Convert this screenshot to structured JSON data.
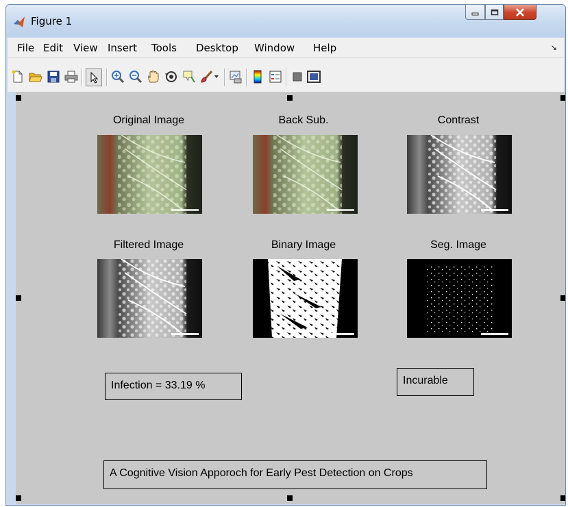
{
  "window": {
    "title": "Figure 1"
  },
  "menu": {
    "items": [
      "File",
      "Edit",
      "View",
      "Insert",
      "Tools",
      "Desktop",
      "Window",
      "Help"
    ]
  },
  "toolbar": {
    "buttons": [
      "new-figure",
      "open-file",
      "save",
      "print",
      "edit-plot",
      "zoom-in",
      "zoom-out",
      "pan",
      "rotate-3d",
      "data-cursor",
      "brush",
      "link-plot",
      "insert-colorbar",
      "insert-legend",
      "hide-plot-tools",
      "show-plot-tools"
    ]
  },
  "figure": {
    "images": [
      {
        "title": "Original Image"
      },
      {
        "title": "Back Sub."
      },
      {
        "title": "Contrast"
      },
      {
        "title": "Filtered Image"
      },
      {
        "title": "Binary Image"
      },
      {
        "title": "Seg. Image"
      }
    ],
    "infection_text": "Infection = 33.19 %",
    "status_text": "Incurable",
    "caption": "A Cognitive Vision Apporoch for Early Pest Detection on Crops"
  },
  "colors": {
    "figure_bg": "#c8c8c8",
    "titlebar": "#c8d9ee",
    "close_button": "#c9442b"
  }
}
